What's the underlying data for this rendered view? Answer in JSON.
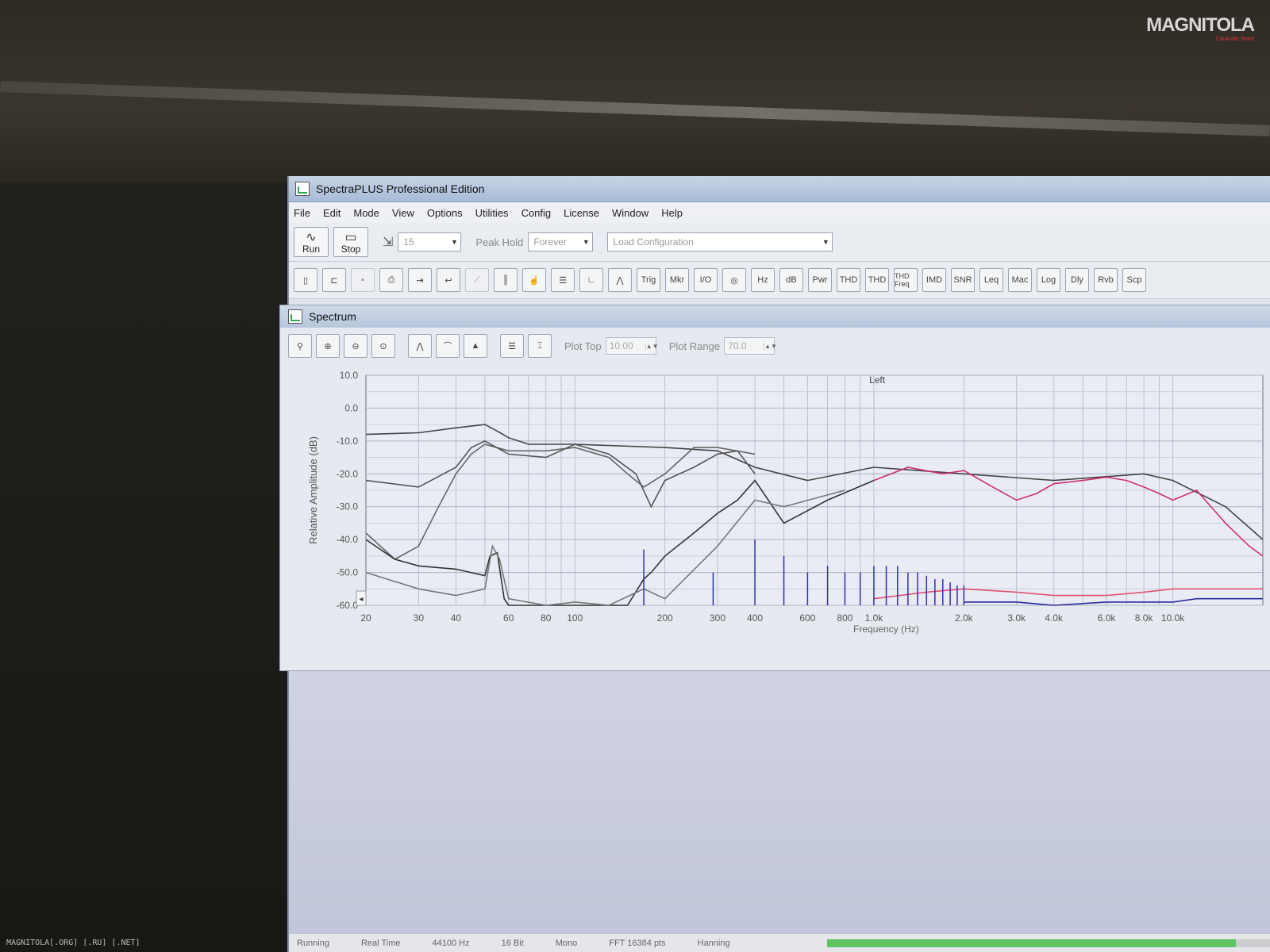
{
  "app": {
    "title": "SpectraPLUS Professional Edition",
    "menu": [
      "File",
      "Edit",
      "Mode",
      "View",
      "Options",
      "Utilities",
      "Config",
      "License",
      "Window",
      "Help"
    ]
  },
  "toolbar1": {
    "run_label": "Run",
    "stop_label": "Stop",
    "average_value": "15",
    "peak_hold_label": "Peak Hold",
    "peak_hold_value": "Forever",
    "config_value": "Load Configuration"
  },
  "toolbar2": {
    "buttons": [
      "Trig",
      "Mkr",
      "I/O",
      "Hz",
      "dB",
      "Pwr",
      "THD",
      "THD",
      "THD Freq",
      "IMD",
      "SNR",
      "Leq",
      "Mac",
      "Log",
      "Dly",
      "Rvb",
      "Scp"
    ]
  },
  "spectrum": {
    "title": "Spectrum",
    "plot_top_label": "Plot Top",
    "plot_top_value": "10.00",
    "plot_range_label": "Plot Range",
    "plot_range_value": "70.0"
  },
  "status": {
    "state": "Running",
    "mode": "Real Time",
    "rate": "44100 Hz",
    "bits": "16 Bit",
    "channels": "Mono",
    "fft": "FFT 16384 pts",
    "window": "Hanning",
    "progress": 0.92
  },
  "chart_data": {
    "type": "line",
    "title": "Left",
    "xlabel": "Frequency (Hz)",
    "ylabel": "Relative Amplitude (dB)",
    "xscale": "log",
    "xlim": [
      20,
      20000
    ],
    "ylim": [
      -60,
      10
    ],
    "yticks": [
      "10.0",
      "0.0",
      "-10.0",
      "-20.0",
      "-30.0",
      "-40.0",
      "-50.0",
      "-60.0"
    ],
    "xticks": [
      {
        "value": 20,
        "label": "20"
      },
      {
        "value": 30,
        "label": "30"
      },
      {
        "value": 40,
        "label": "40"
      },
      {
        "value": 60,
        "label": "60"
      },
      {
        "value": 80,
        "label": "80"
      },
      {
        "value": 100,
        "label": "100"
      },
      {
        "value": 200,
        "label": "200"
      },
      {
        "value": 300,
        "label": "300"
      },
      {
        "value": 400,
        "label": "400"
      },
      {
        "value": 600,
        "label": "600"
      },
      {
        "value": 800,
        "label": "800"
      },
      {
        "value": 1000,
        "label": "1.0k"
      },
      {
        "value": 2000,
        "label": "2.0k"
      },
      {
        "value": 3000,
        "label": "3.0k"
      },
      {
        "value": 4000,
        "label": "4.0k"
      },
      {
        "value": 6000,
        "label": "6.0k"
      },
      {
        "value": 8000,
        "label": "8.0k"
      },
      {
        "value": 10000,
        "label": "10.0k"
      }
    ],
    "grid": true,
    "series": [
      {
        "color": "#444444",
        "x": [
          20,
          30,
          40,
          50,
          55,
          60,
          70,
          100,
          200,
          300,
          400,
          600,
          1000,
          2000,
          4000,
          8000,
          10000,
          15000,
          20000
        ],
        "y": [
          -8,
          -7.5,
          -6,
          -5,
          -7,
          -9,
          -11,
          -11,
          -12,
          -13,
          -18,
          -22,
          -18,
          -20,
          -22,
          -20,
          -22,
          -30,
          -40
        ]
      },
      {
        "color": "#666666",
        "x": [
          20,
          25,
          30,
          35,
          40,
          45,
          50,
          60,
          80,
          100,
          130,
          150,
          170,
          200,
          250,
          300,
          400
        ],
        "y": [
          -38,
          -46,
          -42,
          -30,
          -20,
          -14,
          -11,
          -13,
          -13,
          -12,
          -15,
          -20,
          -24,
          -20,
          -12,
          -12,
          -14
        ]
      },
      {
        "color": "#555555",
        "x": [
          20,
          30,
          40,
          45,
          50,
          60,
          80,
          100,
          130,
          160,
          180,
          200,
          250,
          300,
          350,
          400
        ],
        "y": [
          -22,
          -24,
          -18,
          -12,
          -10,
          -14,
          -15,
          -11,
          -14,
          -20,
          -30,
          -22,
          -18,
          -14,
          -13,
          -20
        ]
      },
      {
        "color": "#333333",
        "x": [
          20,
          25,
          30,
          40,
          50,
          52,
          55,
          58,
          60,
          70,
          100,
          150,
          170,
          180,
          200,
          250,
          300,
          350,
          400,
          500,
          700,
          1000
        ],
        "y": [
          -40,
          -46,
          -48,
          -49,
          -51,
          -45,
          -44,
          -58,
          -60,
          -60,
          -60,
          -60,
          -52,
          -50,
          -45,
          -38,
          -32,
          -28,
          -22,
          -35,
          -28,
          -22
        ]
      },
      {
        "color": "#777777",
        "x": [
          20,
          30,
          40,
          50,
          53,
          56,
          60,
          80,
          100,
          130,
          170,
          200,
          300,
          400,
          500,
          800
        ],
        "y": [
          -50,
          -55,
          -57,
          -55,
          -42,
          -46,
          -58,
          -60,
          -59,
          -60,
          -55,
          -58,
          -42,
          -28,
          -30,
          -25
        ]
      },
      {
        "color": "#d0306a",
        "x": [
          1000,
          1300,
          1700,
          2000,
          2500,
          3000,
          3500,
          4000,
          5000,
          6000,
          7000,
          8000,
          9000,
          10000,
          12000,
          15000,
          18000,
          20000
        ],
        "y": [
          -22,
          -18,
          -20,
          -19,
          -24,
          -28,
          -26,
          -23,
          -22,
          -21,
          -22,
          -24,
          -26,
          -28,
          -25,
          -35,
          -42,
          -45
        ]
      },
      {
        "color": "#e05070",
        "x": [
          1000,
          1500,
          2000,
          3000,
          4000,
          6000,
          8000,
          10000,
          12000,
          15000,
          20000
        ],
        "y": [
          -58,
          -56,
          -55,
          -56,
          -57,
          -57,
          -56,
          -55,
          -55,
          -55,
          -55
        ]
      },
      {
        "color": "#2a2aa0",
        "x": [
          2000,
          3000,
          4000,
          6000,
          8000,
          10000,
          12000,
          15000,
          20000
        ],
        "y": [
          -59,
          -59,
          -60,
          -59,
          -59,
          -59,
          -58,
          -58,
          -58
        ]
      }
    ],
    "harmonic_spikes": {
      "color": "#3030b0",
      "x": [
        170,
        290,
        400,
        500,
        600,
        700,
        800,
        900,
        1000,
        1100,
        1200,
        1300,
        1400,
        1500,
        1600,
        1700,
        1800,
        1900,
        2000
      ],
      "y": [
        -43,
        -50,
        -40,
        -45,
        -50,
        -48,
        -50,
        -50,
        -48,
        -48,
        -48,
        -50,
        -50,
        -51,
        -52,
        -52,
        -53,
        -54,
        -54
      ]
    }
  }
}
